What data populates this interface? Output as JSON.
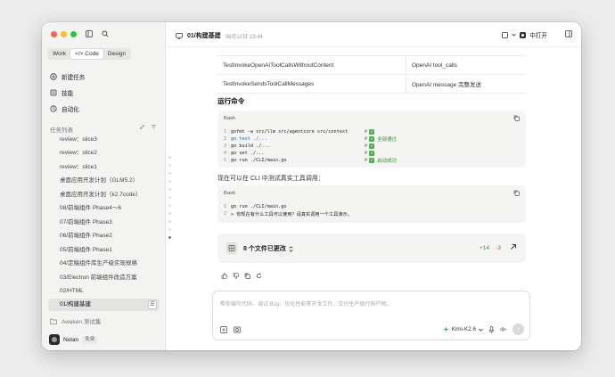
{
  "sidebar": {
    "segments": [
      "Work",
      "Code",
      "Design"
    ],
    "active_segment": "Code",
    "nav": {
      "new_task": "新建任务",
      "skills": "技能",
      "automation": "自动化"
    },
    "section_title": "任务列表",
    "tasks": [
      "review：slice3",
      "review：slice2",
      "review：slice1",
      "桌面应用开发计划（GLM5.2）",
      "桌面应用开发计划（k2.7code）",
      "08/前端组件 Phase4～6",
      "07/前端组件 Phase3",
      "06/前端组件 Phase2",
      "05/前端组件 Phase1",
      "04/定稿组件库生产级实现规格",
      "03/Electron 前端组件改造方案",
      "02/HTML",
      "01/构建基建"
    ],
    "active_task_index": 12,
    "folder": "Awaken 测试集",
    "user": {
      "name": "Nolan",
      "badge": "免费"
    }
  },
  "topbar": {
    "title": "01/构建基建",
    "timestamp": "06月12日 23:44",
    "open_label": "中打开"
  },
  "table": {
    "rows": [
      [
        "TestInvokeOpenAIToolCallsWithoutContent",
        "OpenAI tool_calls"
      ],
      [
        "TestInvokeSendsToolCallMessages",
        "OpenAI message 完整发送"
      ]
    ]
  },
  "content": {
    "heading": "运行命令",
    "block1": {
      "lang": "Bash",
      "lines": [
        {
          "num": "1",
          "code": "gofmt -w src/llm src/agentcore src/context",
          "comment": "#",
          "status": ""
        },
        {
          "num": "2",
          "code": "go test ./...",
          "comment": "#",
          "status": "全部通过"
        },
        {
          "num": "3",
          "code": "go build ./...",
          "comment": "#",
          "status": ""
        },
        {
          "num": "4",
          "code": "go vet ./...",
          "comment": "#",
          "status": ""
        },
        {
          "num": "5",
          "code": "go run ./CLI/main.go",
          "comment": "#",
          "status": "启动成功"
        }
      ]
    },
    "paragraph": "现在可以在 CLI 中测试真实工具调用：",
    "block2": {
      "lang": "Bash",
      "lines": [
        {
          "num": "1",
          "code": "go run ./CLI/main.go"
        },
        {
          "num": "2",
          "code": "> 你现在有什么工具可以使用？请真实调用一个工具演示。"
        }
      ]
    },
    "files": {
      "label": "8 个文件已更改",
      "added": "+14",
      "removed": "-3"
    }
  },
  "composer": {
    "placeholder": "帮你编写代码、调试 Bug、优化性能等开发工作，交付生产级代码产物。",
    "model": "Kimi-K2.6"
  }
}
